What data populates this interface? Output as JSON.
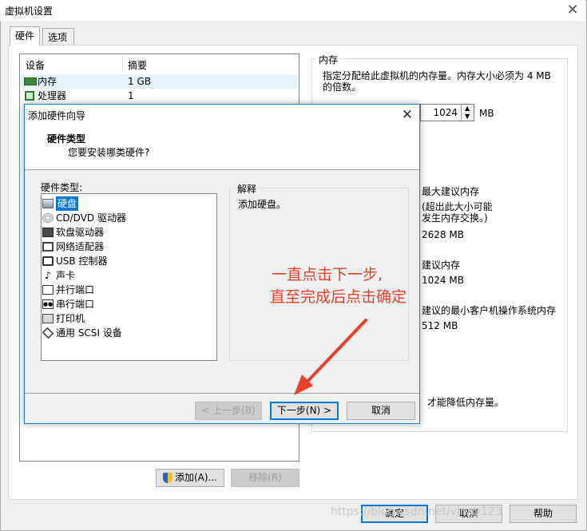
{
  "window": {
    "title": "虚拟机设置",
    "close": "✕"
  },
  "tabs": [
    {
      "label": "硬件"
    },
    {
      "label": "选项"
    }
  ],
  "device_table": {
    "col_device": "设备",
    "col_summary": "摘要",
    "rows": [
      {
        "name": "内存",
        "summary": "1 GB",
        "icon": "memory-icon"
      },
      {
        "name": "处理器",
        "summary": "1",
        "icon": "processor-icon"
      }
    ]
  },
  "device_buttons": {
    "add": "添加(A)...",
    "remove": "移除(R)"
  },
  "memory_panel": {
    "group_title": "内存",
    "description_line1": "指定分配给此虚拟机的内存量。内存大小必须为 4 MB",
    "description_line2": "的倍数。",
    "value": "1024",
    "unit": "MB",
    "max_recommended_label": "最大建议内存",
    "max_recommended_note1": "(超出此大小可能",
    "max_recommended_note2": "发生内存交换。)",
    "max_recommended_value": "2628 MB",
    "recommended_label": "建议内存",
    "recommended_value": "1024 MB",
    "guest_min_label": "建议的最小客户机操作系统内存",
    "guest_min_value": "512 MB",
    "footer_note": "才能降低内存量。"
  },
  "bottom_buttons": {
    "ok": "确定",
    "cancel": "取消",
    "help": "帮助"
  },
  "watermark": "https://blog.csdn.net/vinny123",
  "wizard": {
    "title": "添加硬件向导",
    "close": "✕",
    "heading": "硬件类型",
    "subheading": "您要安装哪类硬件?",
    "list_label": "硬件类型:",
    "items": [
      {
        "label": "硬盘",
        "icon": "hard-disk-icon",
        "selected": true
      },
      {
        "label": "CD/DVD 驱动器",
        "icon": "cd-dvd-icon",
        "selected": false
      },
      {
        "label": "软盘驱动器",
        "icon": "floppy-icon",
        "selected": false
      },
      {
        "label": "网络适配器",
        "icon": "network-adapter-icon",
        "selected": false
      },
      {
        "label": "USB 控制器",
        "icon": "usb-icon",
        "selected": false
      },
      {
        "label": "声卡",
        "icon": "sound-card-icon",
        "selected": false
      },
      {
        "label": "并行端口",
        "icon": "parallel-port-icon",
        "selected": false
      },
      {
        "label": "串行端口",
        "icon": "serial-port-icon",
        "selected": false
      },
      {
        "label": "打印机",
        "icon": "printer-icon",
        "selected": false
      },
      {
        "label": "通用 SCSI 设备",
        "icon": "scsi-icon",
        "selected": false
      }
    ],
    "explain_title": "解释",
    "explain_text": "添加硬盘。",
    "back": "< 上一步(B)",
    "next": "下一步(N) >",
    "cancel": "取消"
  },
  "annotation": {
    "line1": "一直点击下一步,",
    "line2": "直至完成后点击确定",
    "color": "#e8402a"
  }
}
